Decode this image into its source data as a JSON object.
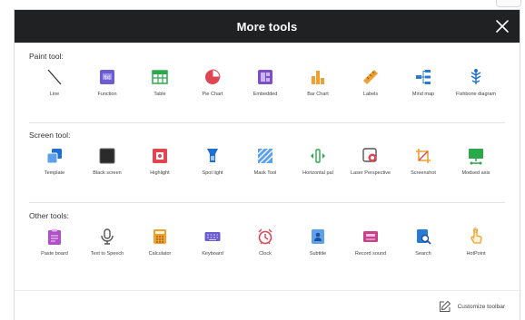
{
  "dialog": {
    "title": "More tools",
    "close_icon": "close-icon"
  },
  "sections": {
    "paint": {
      "label": "Paint tool:",
      "items": [
        {
          "label": "Line",
          "icon": "line-icon"
        },
        {
          "label": "Function",
          "icon": "function-icon"
        },
        {
          "label": "Table",
          "icon": "table-icon"
        },
        {
          "label": "Pie Chart",
          "icon": "pie-chart-icon"
        },
        {
          "label": "Embedded",
          "icon": "embedded-icon"
        },
        {
          "label": "Bar Chart",
          "icon": "bar-chart-icon"
        },
        {
          "label": "Labels",
          "icon": "ruler-icon"
        },
        {
          "label": "Mind map",
          "icon": "mind-map-icon"
        },
        {
          "label": "Fishbone diagram",
          "icon": "fishbone-icon"
        }
      ]
    },
    "screen": {
      "label": "Screen tool:",
      "items": [
        {
          "label": "Template",
          "icon": "template-icon"
        },
        {
          "label": "Black screen",
          "icon": "black-screen-icon"
        },
        {
          "label": "Highlight",
          "icon": "highlight-icon"
        },
        {
          "label": "Spot light",
          "icon": "spotlight-icon"
        },
        {
          "label": "Mask Tool",
          "icon": "mask-icon"
        },
        {
          "label": "Horizontal pal",
          "icon": "horizontal-icon"
        },
        {
          "label": "Laser Perspective",
          "icon": "laser-icon"
        },
        {
          "label": "Screenshot",
          "icon": "screenshot-icon"
        },
        {
          "label": "Modsed axis",
          "icon": "axis-icon"
        }
      ]
    },
    "other": {
      "label": "Other tools:",
      "items": [
        {
          "label": "Paste board",
          "icon": "clipboard-icon"
        },
        {
          "label": "Text to Speech",
          "icon": "microphone-icon"
        },
        {
          "label": "Calculator",
          "icon": "calculator-icon"
        },
        {
          "label": "Keyboard",
          "icon": "keyboard-icon"
        },
        {
          "label": "Clock",
          "icon": "alarm-clock-icon"
        },
        {
          "label": "Subtitle",
          "icon": "subtitle-icon"
        },
        {
          "label": "Record sound",
          "icon": "record-icon"
        },
        {
          "label": "Search",
          "icon": "search-icon"
        },
        {
          "label": "HotPoint",
          "icon": "hotpoint-icon"
        }
      ]
    }
  },
  "footer": {
    "customize_label": "Customize toolbar"
  },
  "colors": {
    "titlebar": "#202122",
    "accent_blue": "#1e6fd0",
    "accent_red": "#e04552",
    "accent_green": "#2aa84a",
    "accent_purple": "#7a4fc8",
    "accent_orange": "#f0a030"
  }
}
